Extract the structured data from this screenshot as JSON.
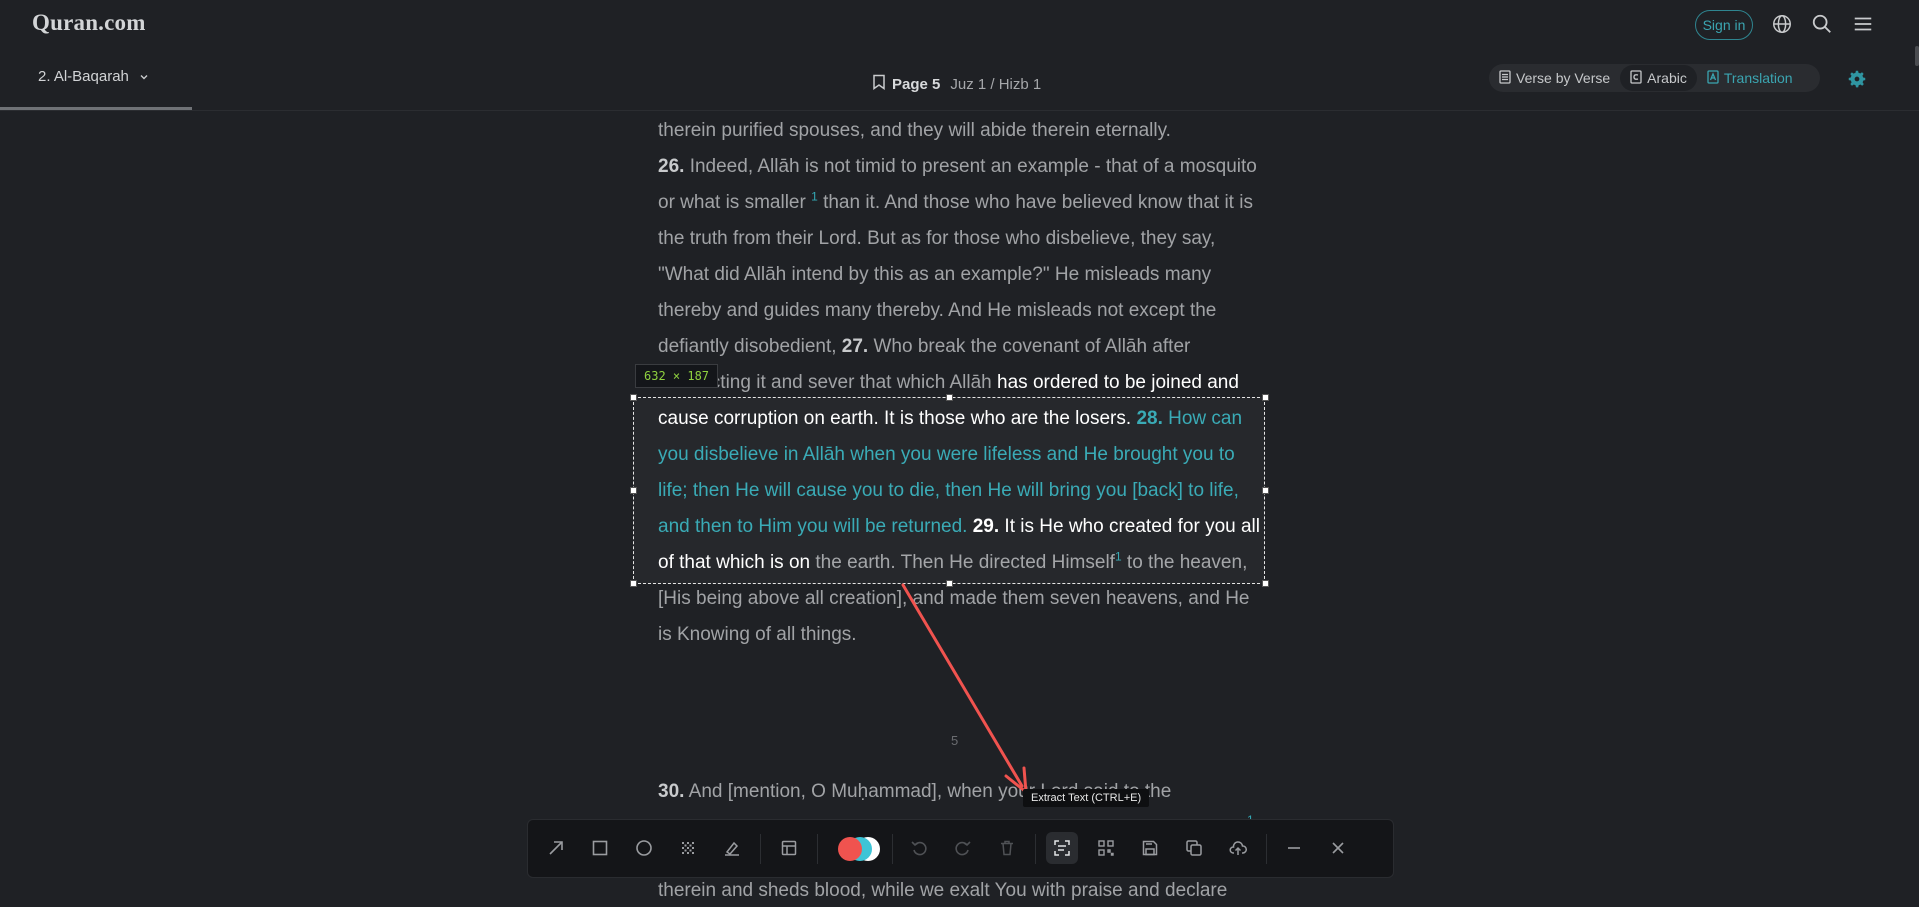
{
  "header": {
    "logo": "Quran.com",
    "sign_in": "Sign in",
    "icons": [
      "globe-icon",
      "search-icon",
      "menu-icon"
    ]
  },
  "navbar": {
    "surah": "2. Al-Baqarah",
    "page_label": "Page 5",
    "juz_label": "Juz 1 / Hizb 1",
    "modes": [
      "Verse by Verse",
      "Arabic",
      "Translation"
    ],
    "active_mode": "Translation"
  },
  "content": {
    "line_intro": "therein purified spouses, and they will abide therein eternally.",
    "v26_num": "26.",
    "v26_a": " Indeed, Allāh is not timid to present an example - that of a mosquito or what is smaller",
    "fn1": "1",
    "v26_b": " than it. And those who have believed know that it is the truth from their Lord. But as for those who disbelieve, they say, \"What did Allāh intend by this as an example?\" He misleads many thereby and guides many thereby. And He misleads not except the defiantly disobedient, ",
    "v27_num": "27.",
    "v27_a": " Who break the covenant of Allāh after contracting it and sever that which Allāh",
    "v27_b": " has ordered to be joined and cause corruption on earth. It is those who are the losers. ",
    "v28_num": "28.",
    "v28": " How can you disbelieve in Allāh when you were lifeless and He brought you to life; then He will cause you to die, then He will bring you [back] to life, and then to Him you will be returned. ",
    "v29_num": "29.",
    "v29_a": " It is He who created for you all of that which is on",
    "v29_b": " the earth. Then He directed Himself",
    "fn2": "1",
    "v29_c": " to the heaven, [His being above all creation], and made them seven heavens, and He is Knowing of all things.",
    "page_number": "5",
    "v30_num": "30.",
    "v30_a": " And [mention, O Muḥammad], when your Lord said to the",
    "fn3": "1",
    "v30_end": "therein and sheds blood, while we exalt You with praise and declare"
  },
  "capture": {
    "dimensions": "632 × 187",
    "tooltip": "Extract Text (CTRL+E)",
    "arrow_color": "#f0534f",
    "colors": [
      "#f0534f",
      "#3ec4d6",
      "#ffffff"
    ],
    "tools": [
      "arrow-tool",
      "rectangle-tool",
      "ellipse-tool",
      "mosaic-tool",
      "highlighter-tool",
      "layout-tool",
      "undo",
      "redo",
      "delete",
      "extract-text",
      "qr-scan",
      "save",
      "copy",
      "upload",
      "minimize",
      "close"
    ]
  }
}
